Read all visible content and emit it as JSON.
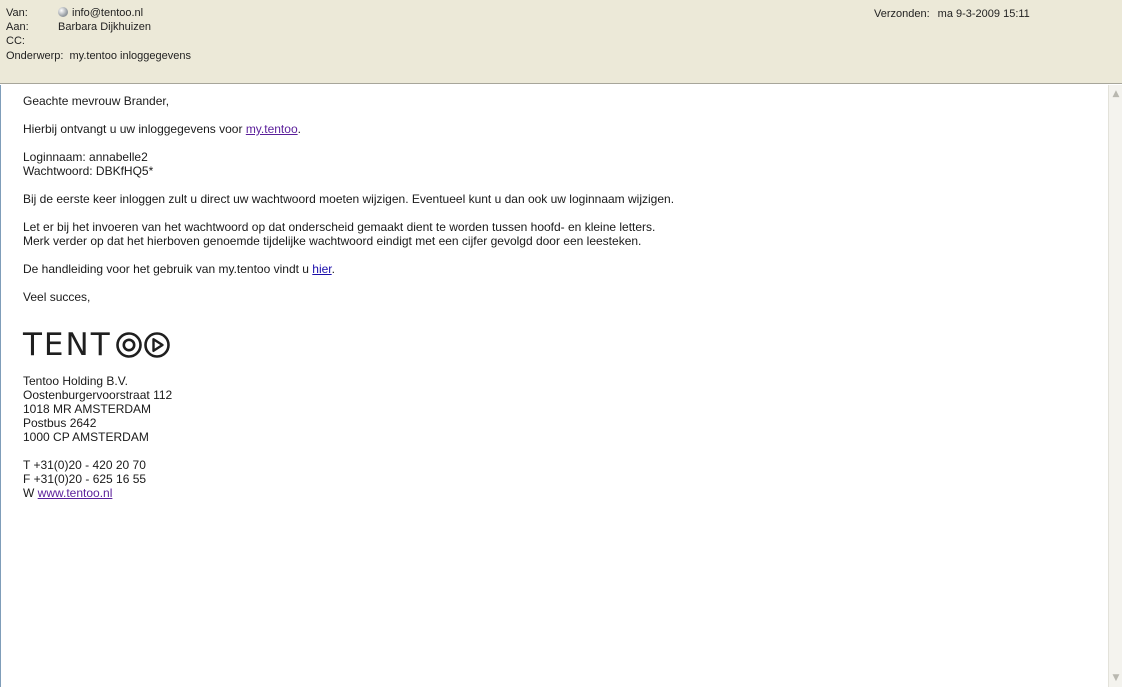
{
  "header": {
    "from_label": "Van:",
    "from_value": "info@tentoo.nl",
    "to_label": "Aan:",
    "to_value": "Barbara Dijkhuizen",
    "cc_label": "CC:",
    "cc_value": "",
    "subject_label": "Onderwerp:",
    "subject_value": "my.tentoo inloggegevens",
    "sent_label": "Verzonden:",
    "sent_value": "ma 9-3-2009 15:11"
  },
  "body": {
    "greeting": "Geachte mevrouw Brander,",
    "intro_text": "Hierbij ontvangt u uw inloggegevens voor ",
    "intro_link": "my.tentoo",
    "intro_end": ".",
    "login_line": "Loginnaam: annabelle2",
    "password_line": "Wachtwoord: DBKfHQ5*",
    "first_login": "Bij de eerste keer inloggen zult u direct uw wachtwoord moeten wijzigen. Eventueel kunt u dan ook uw loginnaam wijzigen.",
    "case_note": "Let er bij het invoeren van het wachtwoord op dat onderscheid gemaakt dient te worden tussen hoofd- en kleine letters.",
    "pw_note": "Merk verder op dat het hierboven genoemde tijdelijke wachtwoord eindigt met een cijfer gevolgd door een leesteken.",
    "manual_text": "De handleiding voor het gebruik van my.tentoo vindt u ",
    "manual_link": "hier",
    "manual_end": ".",
    "closing": "Veel succes,"
  },
  "logo": {
    "text": "TENT"
  },
  "signature": {
    "company": "Tentoo Holding B.V.",
    "street": "Oostenburgervoorstraat 112",
    "city1": "1018 MR AMSTERDAM",
    "pobox": "Postbus 2642",
    "city2": "1000 CP AMSTERDAM",
    "phone": "T +31(0)20 - 420 20 70",
    "fax": "F +31(0)20 - 625 16 55",
    "web_prefix": "W ",
    "web_link": "www.tentoo.nl"
  },
  "icons": {
    "sender": "contact-dot-icon",
    "scroll_up": "chevron-up-icon",
    "scroll_down": "chevron-down-icon"
  }
}
